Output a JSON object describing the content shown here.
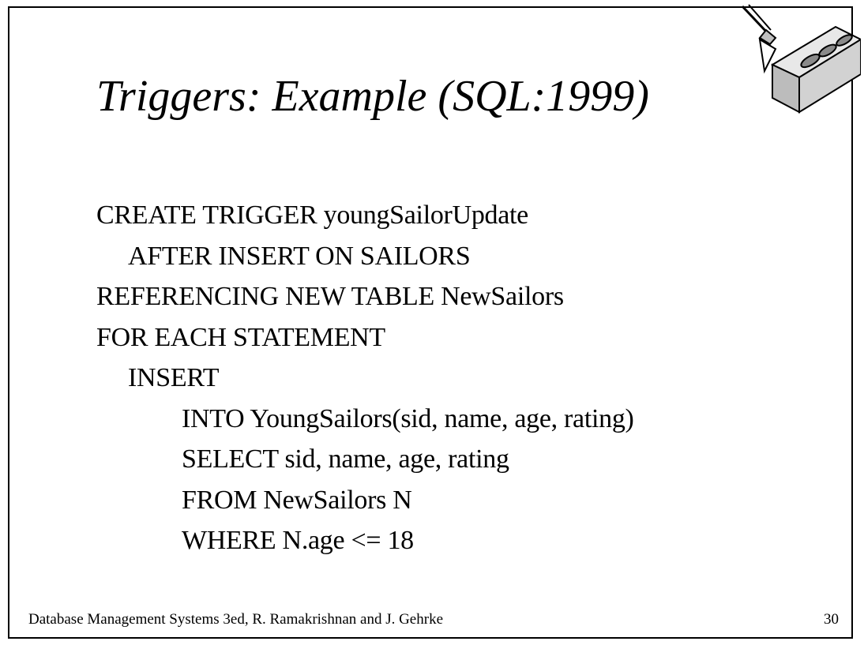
{
  "slide": {
    "title": "Triggers: Example (SQL:1999)",
    "code_lines": [
      "CREATE TRIGGER youngSailorUpdate",
      "AFTER INSERT ON SAILORS",
      "REFERENCING NEW TABLE NewSailors",
      "FOR EACH STATEMENT",
      "INSERT",
      "INTO YoungSailors(sid, name, age, rating)",
      "SELECT sid, name, age, rating",
      "FROM NewSailors N",
      "WHERE N.age <= 18"
    ],
    "footer": {
      "citation": "Database Management Systems 3ed,  R. Ramakrishnan and J. Gehrke",
      "page_number": "30"
    },
    "logo_icon": "brick-and-trowel-icon"
  }
}
